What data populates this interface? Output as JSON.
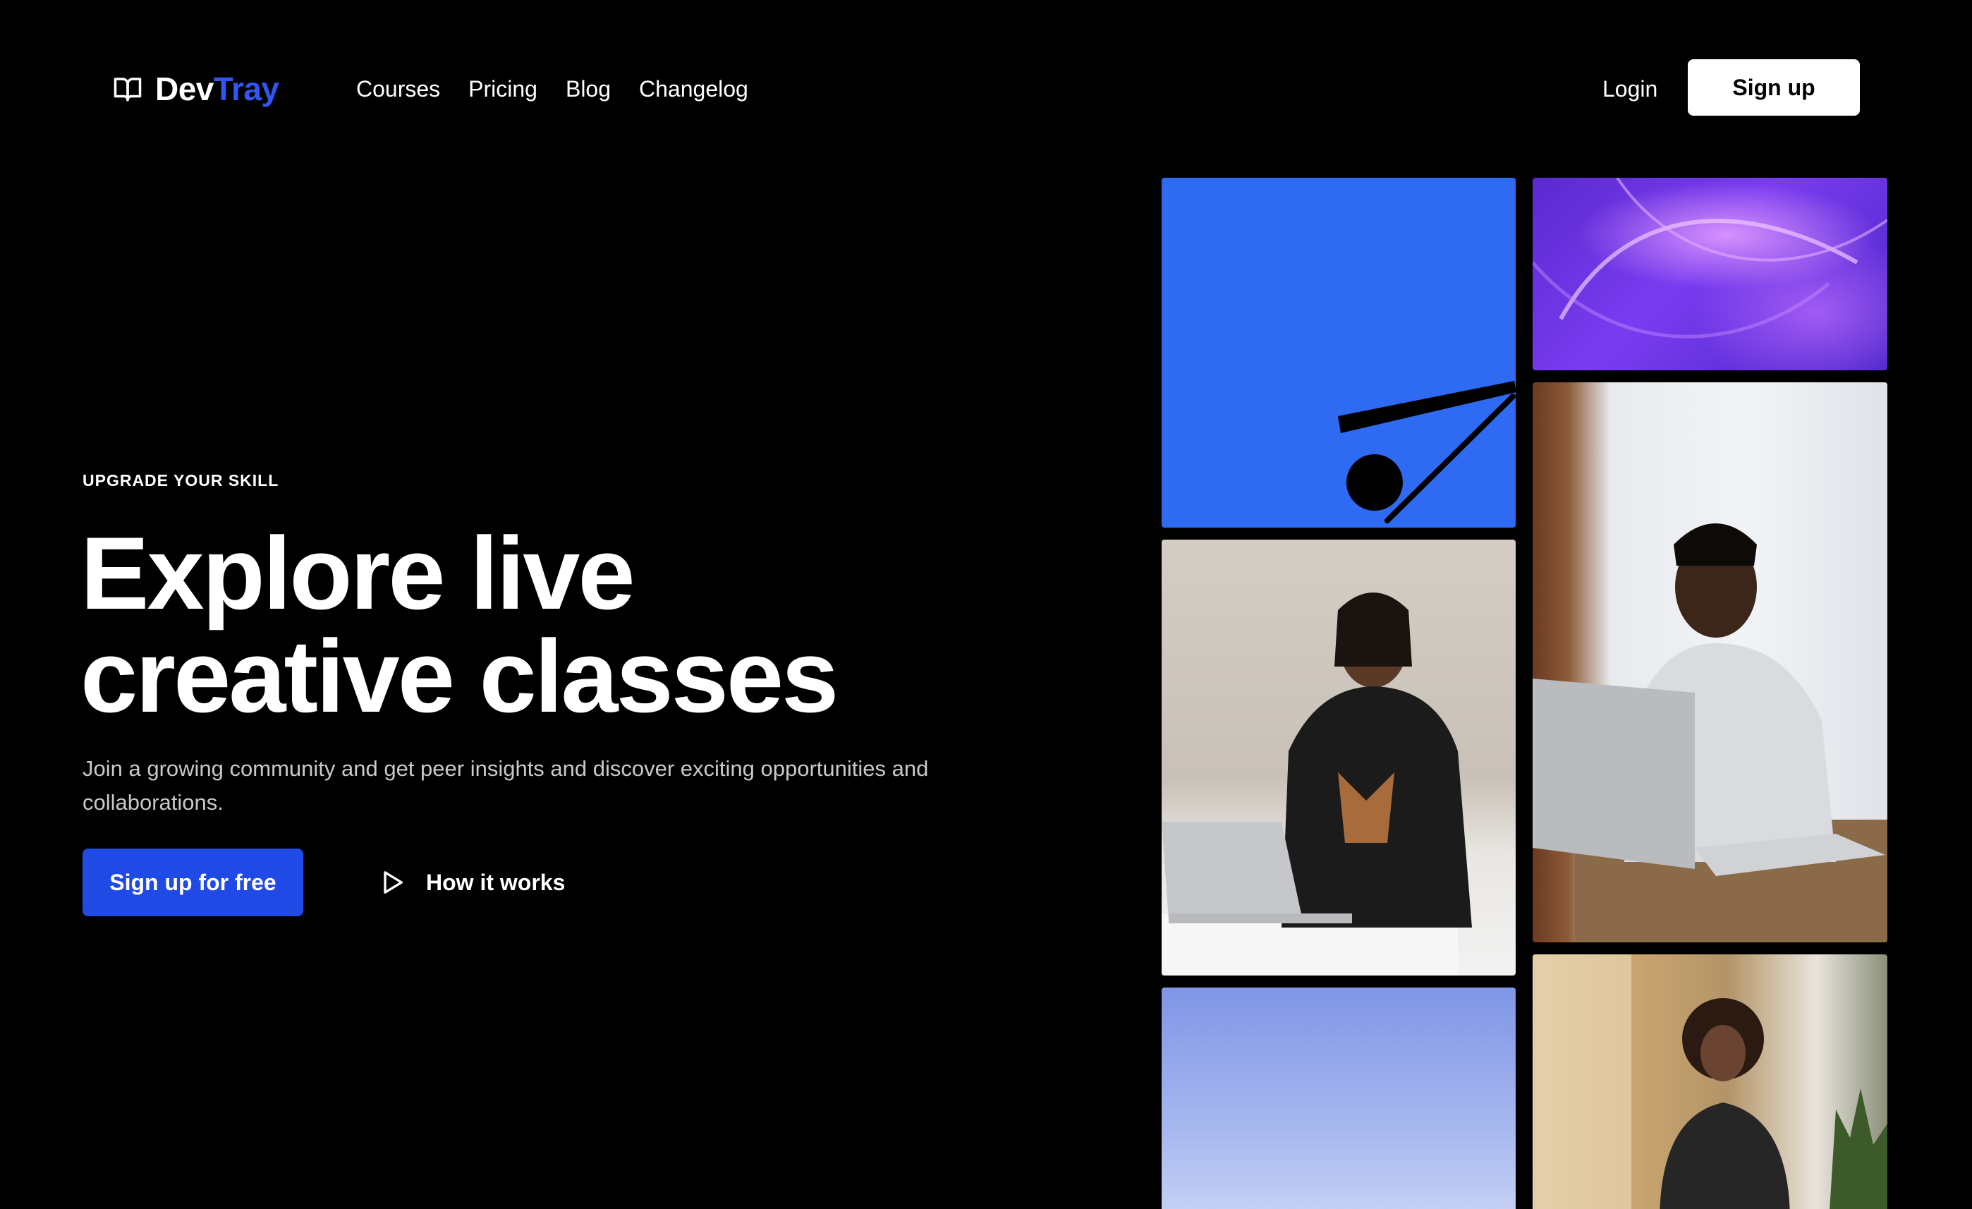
{
  "brand": {
    "name_part1": "Dev",
    "name_part2": "Tray",
    "icon": "book-open-icon",
    "accent_color": "#3057f5"
  },
  "nav": {
    "items": [
      {
        "label": "Courses"
      },
      {
        "label": "Pricing"
      },
      {
        "label": "Blog"
      },
      {
        "label": "Changelog"
      }
    ]
  },
  "auth": {
    "login_label": "Login",
    "signup_label": "Sign up"
  },
  "hero": {
    "eyebrow": "UPGRADE YOUR SKILL",
    "headline_line1": "Explore live",
    "headline_line2": "creative classes",
    "subtext": "Join a growing community and get peer insights and discover exciting opportunities and collaborations.",
    "cta_primary": "Sign up for free",
    "cta_secondary": "How it works",
    "cta_secondary_icon": "play-icon",
    "cta_primary_color": "#1f4ae6"
  }
}
